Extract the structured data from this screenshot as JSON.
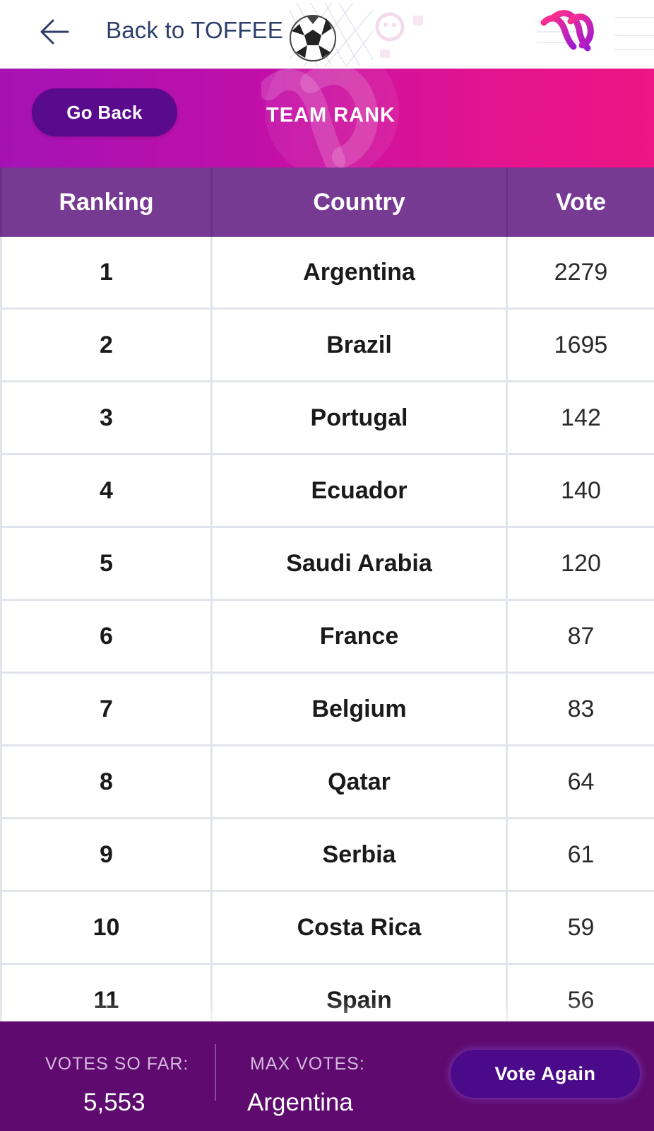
{
  "nav": {
    "back_label": "Back to TOFFEE"
  },
  "banner": {
    "go_back_label": "Go Back",
    "title": "TEAM RANK"
  },
  "table": {
    "headers": [
      "Ranking",
      "Country",
      "Vote"
    ],
    "rows": [
      {
        "rank": "1",
        "country": "Argentina",
        "votes": "2279"
      },
      {
        "rank": "2",
        "country": "Brazil",
        "votes": "1695"
      },
      {
        "rank": "3",
        "country": "Portugal",
        "votes": "142"
      },
      {
        "rank": "4",
        "country": "Ecuador",
        "votes": "140"
      },
      {
        "rank": "5",
        "country": "Saudi Arabia",
        "votes": "120"
      },
      {
        "rank": "6",
        "country": "France",
        "votes": "87"
      },
      {
        "rank": "7",
        "country": "Belgium",
        "votes": "83"
      },
      {
        "rank": "8",
        "country": "Qatar",
        "votes": "64"
      },
      {
        "rank": "9",
        "country": "Serbia",
        "votes": "61"
      },
      {
        "rank": "10",
        "country": "Costa Rica",
        "votes": "59"
      },
      {
        "rank": "11",
        "country": "Spain",
        "votes": "56"
      }
    ]
  },
  "footer": {
    "votes_label": "VOTES SO FAR:",
    "votes_value": "5,553",
    "max_label": "MAX VOTES:",
    "max_value": "Argentina",
    "vote_again_label": "Vote Again"
  },
  "icons": {
    "back": "arrow-left-icon",
    "ball": "soccer-ball-icon",
    "logo": "brand-logo"
  },
  "colors": {
    "banner_start": "#a412b5",
    "banner_end": "#ee1585",
    "table_header": "#763a93",
    "footer_bg": "#5e0a6e",
    "button_bg": "#5a0a8c",
    "nav_text": "#2d3e6b"
  }
}
